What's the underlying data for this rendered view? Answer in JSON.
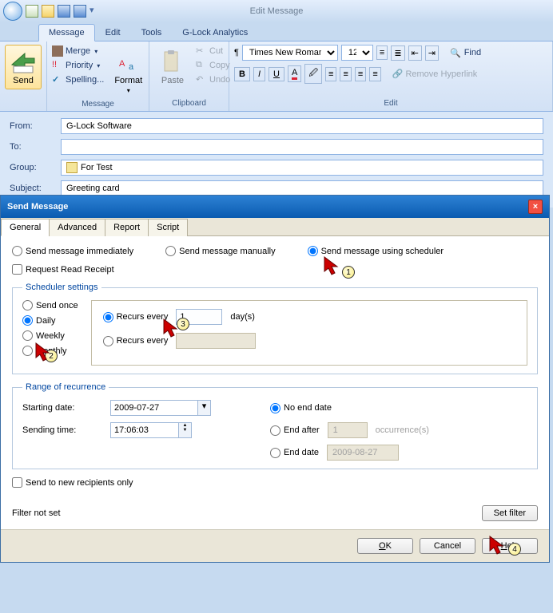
{
  "window": {
    "title": "Edit Message"
  },
  "ribbon": {
    "tabs": [
      "Message",
      "Edit",
      "Tools",
      "G-Lock Analytics"
    ],
    "send": "Send",
    "message_group": {
      "merge": "Merge",
      "priority": "Priority",
      "spelling": "Spelling...",
      "format": "Format",
      "label": "Message"
    },
    "clipboard_group": {
      "paste": "Paste",
      "cut": "Cut",
      "copy": "Copy",
      "undo": "Undo",
      "label": "Clipboard"
    },
    "edit_group": {
      "font_name": "Times New Roman",
      "font_size": "12",
      "find": "Find",
      "remove_link": "Remove Hyperlink",
      "label": "Edit"
    }
  },
  "fields": {
    "from_label": "From:",
    "from_value": "G-Lock Software",
    "to_label": "To:",
    "to_value": "",
    "group_label": "Group:",
    "group_value": "For Test",
    "subject_label": "Subject:",
    "subject_value": "Greeting card"
  },
  "dialog": {
    "title": "Send Message",
    "tabs": [
      "General",
      "Advanced",
      "Report",
      "Script"
    ],
    "send_mode": {
      "immediately": "Send message immediately",
      "manually": "Send message manually",
      "scheduler": "Send message using scheduler"
    },
    "read_receipt": "Request Read Receipt",
    "scheduler": {
      "legend": "Scheduler settings",
      "send_once": "Send once",
      "daily": "Daily",
      "weekly": "Weekly",
      "monthly": "Monthly",
      "recurs_every": "Recurs every",
      "recurs_val": "1",
      "recurs_unit": "day(s)",
      "recurs_every_alt": "Recurs every"
    },
    "range": {
      "legend": "Range of recurrence",
      "start_label": "Starting date:",
      "start_date": "2009-07-27",
      "time_label": "Sending time:",
      "time_val": "17:06:03",
      "no_end": "No end date",
      "end_after": "End after",
      "end_after_val": "1",
      "occurrences": "occurrence(s)",
      "end_date": "End date",
      "end_date_val": "2009-08-27"
    },
    "new_recipients": "Send to new recipients only",
    "filter_status": "Filter not set",
    "set_filter": "Set filter",
    "buttons": {
      "ok": "OK",
      "cancel": "Cancel",
      "help": "Help"
    }
  }
}
